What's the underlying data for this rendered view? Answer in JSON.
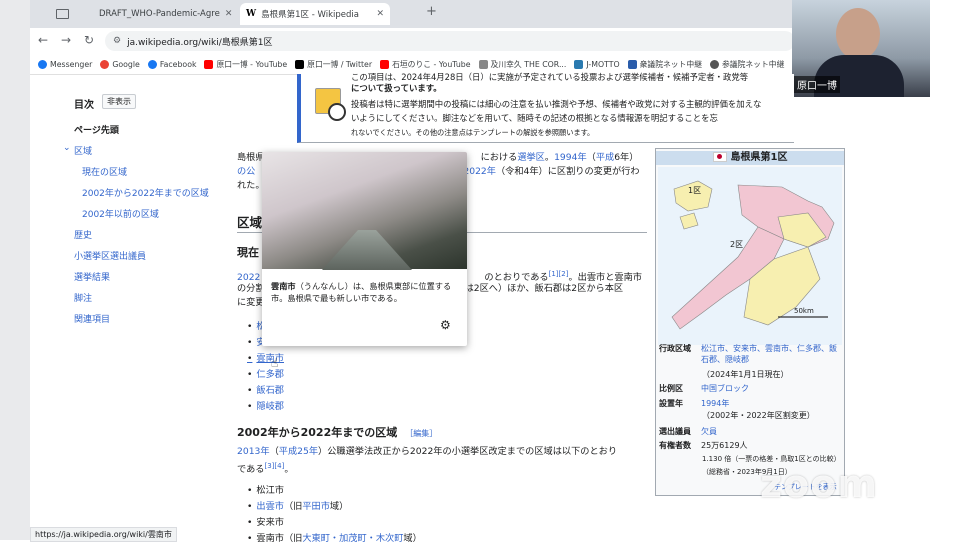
{
  "browser": {
    "tabs": [
      {
        "title": "",
        "icon": "window-icon"
      },
      {
        "title": "DRAFT_WHO-Pandemic-Agre",
        "icon": "wordpress-icon"
      },
      {
        "title": "島根県第1区 - Wikipedia",
        "icon": "wikipedia-icon"
      }
    ],
    "new_tab": "+",
    "url": "ja.wikipedia.org/wiki/島根県第1区",
    "bookmarks": [
      {
        "label": "Messenger",
        "color": "#1877f2"
      },
      {
        "label": "Google",
        "color": "#ea4335"
      },
      {
        "label": "Facebook",
        "color": "#1877f2"
      },
      {
        "label": "原口一博 - YouTube",
        "color": "#ff0000"
      },
      {
        "label": "原口一博 / Twitter",
        "color": "#000000"
      },
      {
        "label": "石垣のりこ - YouTube",
        "color": "#ff0000"
      },
      {
        "label": "及川幸久 THE COR...",
        "color": "#888888"
      },
      {
        "label": "J-MOTTO",
        "color": "#2a7ab0"
      },
      {
        "label": "衆議院ネット中継",
        "color": "#2a5caa"
      },
      {
        "label": "参議院ネット中継",
        "color": "#555555"
      }
    ],
    "status_url": "https://ja.wikipedia.org/wiki/雲南市"
  },
  "video": {
    "name": "原口一博"
  },
  "toc": {
    "title": "目次",
    "hide": "非表示",
    "items": [
      {
        "label": "ページ先頭",
        "bold": true
      },
      {
        "label": "区域",
        "bold": false
      },
      {
        "label": "現在の区域",
        "bold": false
      },
      {
        "label": "2002年から2022年までの区域",
        "bold": false
      },
      {
        "label": "2002年以前の区域",
        "bold": false
      },
      {
        "label": "歴史",
        "bold": false
      },
      {
        "label": "小選挙区選出議員",
        "bold": false
      },
      {
        "label": "選挙結果",
        "bold": false
      },
      {
        "label": "脚注",
        "bold": false
      },
      {
        "label": "関連項目",
        "bold": false
      }
    ]
  },
  "notice": {
    "line1": "この項目は、2024年4月28日（日）に実施が予定されている投票および選挙候補者・候補予定者・政党等",
    "line2": "について扱っています。",
    "line3": "投稿者は特に選挙期間中の投稿には細心の注意を払い推測や予想、候補者や政党に対する主観的評価を加えな",
    "line4": "いようにしてください。脚注などを用いて、随時その記述の根拠となる情報源を明記することを忘",
    "line5": "れないでください。その他の注意点はテンプレートの解説を参照願います。"
  },
  "article": {
    "intro1_a": "島根県",
    "intro1_b": "における",
    "intro1_c": "選挙区",
    "intro1_d": "。",
    "intro1_e": "1994年",
    "intro1_f": "（",
    "intro1_g": "平成",
    "intro1_h": "6年）",
    "intro2_a": "の公",
    "intro2_b": "2022年",
    "intro2_c": "（令和4年）に区割りの変更が行わ",
    "intro3": "れた。",
    "h2_area": "区域",
    "h3_current": "現在",
    "cur1_a": "2022",
    "cur1_b": "のとおりである",
    "cur1_ref": "[1][2]",
    "cur1_c": "。出雲市と雲南市",
    "cur2": "の分割",
    "cur2_b": "は2区へ）ほか、飯石郡は2区から本区",
    "cur3": "に変更",
    "list_current": [
      "松江市",
      "安来市",
      "雲南市",
      "仁多郡",
      "飯石郡",
      "隠岐郡"
    ],
    "h3_2002": "2002年から2022年までの区域",
    "edit": "［編集］",
    "p2002_1_a": "2013年",
    "p2002_1_b": "（",
    "p2002_1_c": "平成25年",
    "p2002_1_d": "）公職選挙法改正から2022年の小選挙区改定までの区域は以下のとおり",
    "p2002_2": "である",
    "p2002_ref": "[3][4]",
    "p2002_2b": "。",
    "list_2002": [
      {
        "text": "松江市",
        "link": ""
      },
      {
        "text": "（旧",
        "link": "出雲市",
        "link2": "平田市",
        "tail": "域）"
      },
      {
        "text": "安来市",
        "link": ""
      },
      {
        "text": "（旧",
        "link": "雲南市",
        "link2": "大東町・加茂町・木次町",
        "tail": "域）"
      }
    ]
  },
  "popup": {
    "bold": "雲南市",
    "text": "（うんなんし）は、島根県東部に位置する市。島根県で最も新しい市である。"
  },
  "infobox": {
    "title": "島根県第1区",
    "map_label1": "1区",
    "map_label2": "2区",
    "scale": "50km",
    "rows": [
      {
        "label": "行政区域",
        "value": "松江市、安来市、雲南市、仁多郡、飯石郡、隠岐郡"
      },
      {
        "label": "",
        "value": "（2024年1月1日現在）"
      },
      {
        "label": "比例区",
        "value": "中国ブロック"
      },
      {
        "label": "設置年",
        "value": "1994年"
      },
      {
        "label": "",
        "value": "（2002年・2022年区割変更）"
      },
      {
        "label": "選出議員",
        "value": "欠員"
      },
      {
        "label": "有権者数",
        "value": "25万6129人"
      },
      {
        "label": "",
        "value": "1.130 倍（一票の格差・鳥取1区との比較）"
      },
      {
        "label": "",
        "value": "（総務省・2023年9月1日）"
      },
      {
        "label": "",
        "value": "テンプレートを表示"
      }
    ]
  },
  "watermark": "zoom",
  "colors": {
    "link": "#3366cc",
    "tabstrip": "#dee1e6",
    "notice_border": "#3366cc"
  }
}
